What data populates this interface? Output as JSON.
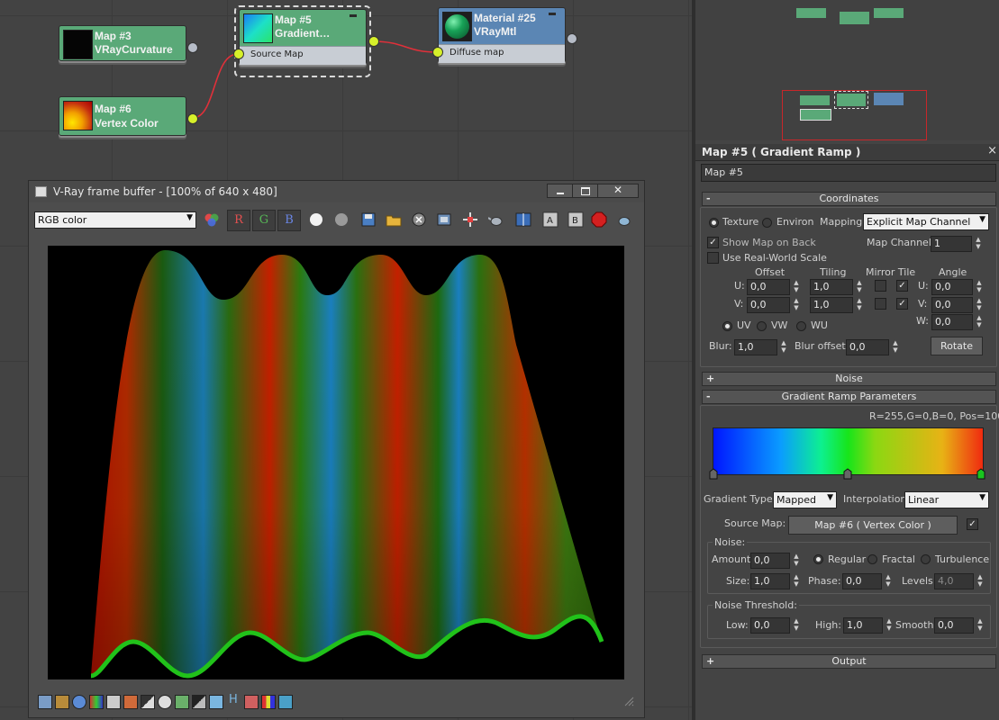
{
  "nodes": {
    "map3": {
      "title": "Map #3",
      "subtitle": "VRayCurvature"
    },
    "map5": {
      "title": "Map #5",
      "subtitle": "Gradient…",
      "slot": "Source Map"
    },
    "material25": {
      "title": "Material #25",
      "subtitle": "VRayMtl",
      "slot": "Diffuse map"
    },
    "map6": {
      "title": "Map #6",
      "subtitle": "Vertex Color"
    }
  },
  "vfb": {
    "title": "V-Ray frame buffer - [100% of 640 x 480]",
    "channel": "RGB color",
    "rgb_buttons": [
      "R",
      "G",
      "B"
    ]
  },
  "panel": {
    "header": "Map #5  ( Gradient Ramp )",
    "name_field": "Map #5",
    "rollouts": {
      "coordinates": "Coordinates",
      "noise": "Noise",
      "gradient": "Gradient Ramp Parameters",
      "output": "Output"
    },
    "coords": {
      "texture": "Texture",
      "environ": "Environ",
      "mapping_label": "Mapping:",
      "mapping_value": "Explicit Map Channel",
      "show_map_on_back": "Show Map on Back",
      "map_channel_label": "Map Channel:",
      "map_channel_value": "1",
      "real_world": "Use Real-World Scale",
      "offset": "Offset",
      "tiling": "Tiling",
      "mirror_tile": "Mirror Tile",
      "angle": "Angle",
      "u_label": "U:",
      "v_label": "V:",
      "w_label": "W:",
      "u_offset": "0,0",
      "v_offset": "0,0",
      "u_tiling": "1,0",
      "v_tiling": "1,0",
      "u_angle": "0,0",
      "v_angle": "0,0",
      "w_angle": "0,0",
      "uv": "UV",
      "vw": "VW",
      "wu": "WU",
      "blur_label": "Blur:",
      "blur_value": "1,0",
      "blur_offset_label": "Blur offset:",
      "blur_offset_value": "0,0",
      "rotate": "Rotate"
    },
    "gradient": {
      "readout": "R=255,G=0,B=0, Pos=100",
      "type_label": "Gradient Type:",
      "type_value": "Mapped",
      "interp_label": "Interpolation:",
      "interp_value": "Linear",
      "source_map_label": "Source Map:",
      "source_map_value": "Map #6  ( Vertex Color )",
      "noise_group": "Noise:",
      "amount_label": "Amount:",
      "amount_value": "0,0",
      "regular": "Regular",
      "fractal": "Fractal",
      "turbulence": "Turbulence",
      "size_label": "Size:",
      "size_value": "1,0",
      "phase_label": "Phase:",
      "phase_value": "0,0",
      "levels_label": "Levels:",
      "levels_value": "4,0",
      "threshold_group": "Noise Threshold:",
      "low_label": "Low:",
      "low_value": "0,0",
      "high_label": "High:",
      "high_value": "1,0",
      "smooth_label": "Smooth:",
      "smooth_value": "0,0"
    }
  },
  "colors": {
    "node_green": "#5aa978",
    "node_blue": "#5b86b4",
    "wire": "#e0303a",
    "socket": "#d7f02a"
  }
}
